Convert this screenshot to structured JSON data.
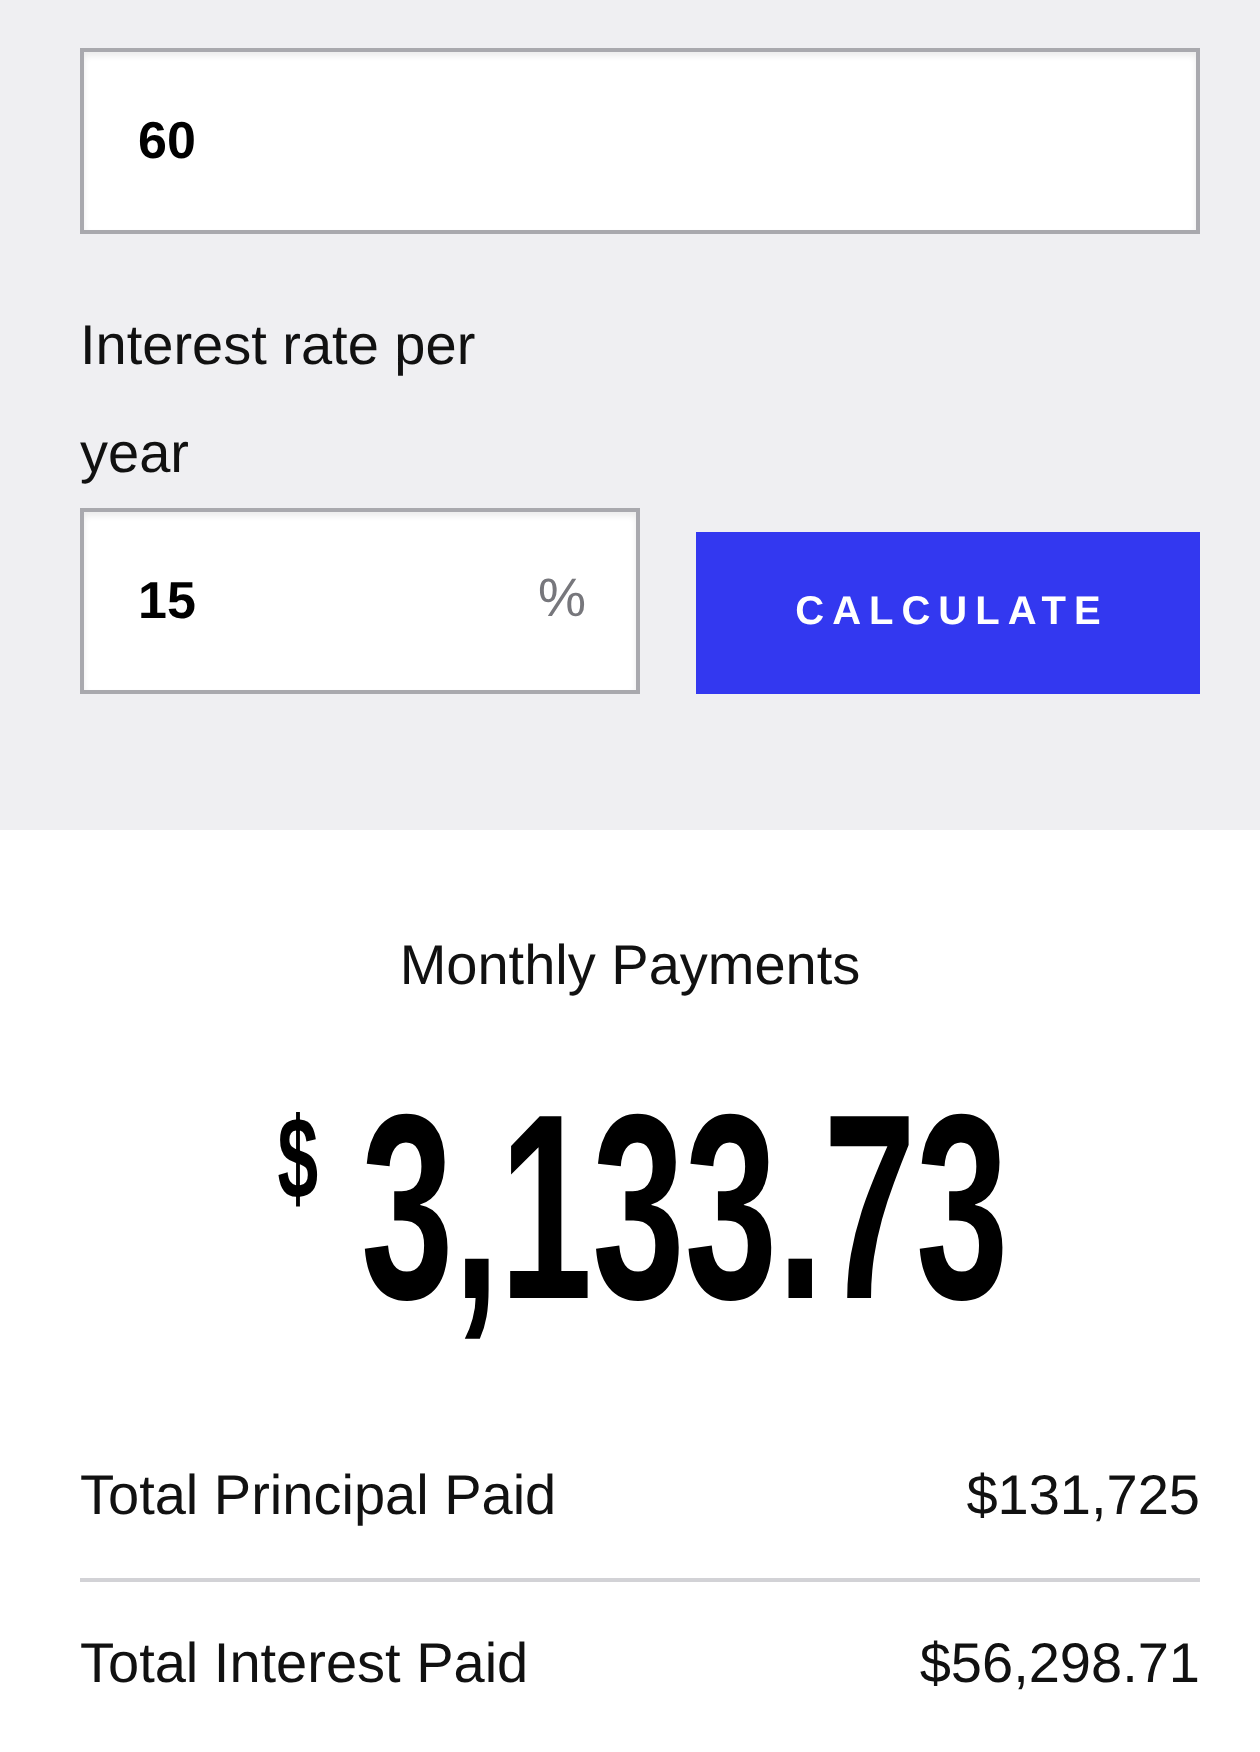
{
  "top_field": {
    "value": "60"
  },
  "rate_field": {
    "label": "Interest rate per year",
    "value": "15",
    "unit": "%"
  },
  "calculate_button": {
    "label": "CALCULATE"
  },
  "result": {
    "title": "Monthly Payments",
    "currency": "$",
    "amount": "3,133.73"
  },
  "summary": [
    {
      "label": "Total Principal Paid",
      "value": "$131,725"
    },
    {
      "label": "Total Interest Paid",
      "value": "$56,298.71"
    }
  ]
}
